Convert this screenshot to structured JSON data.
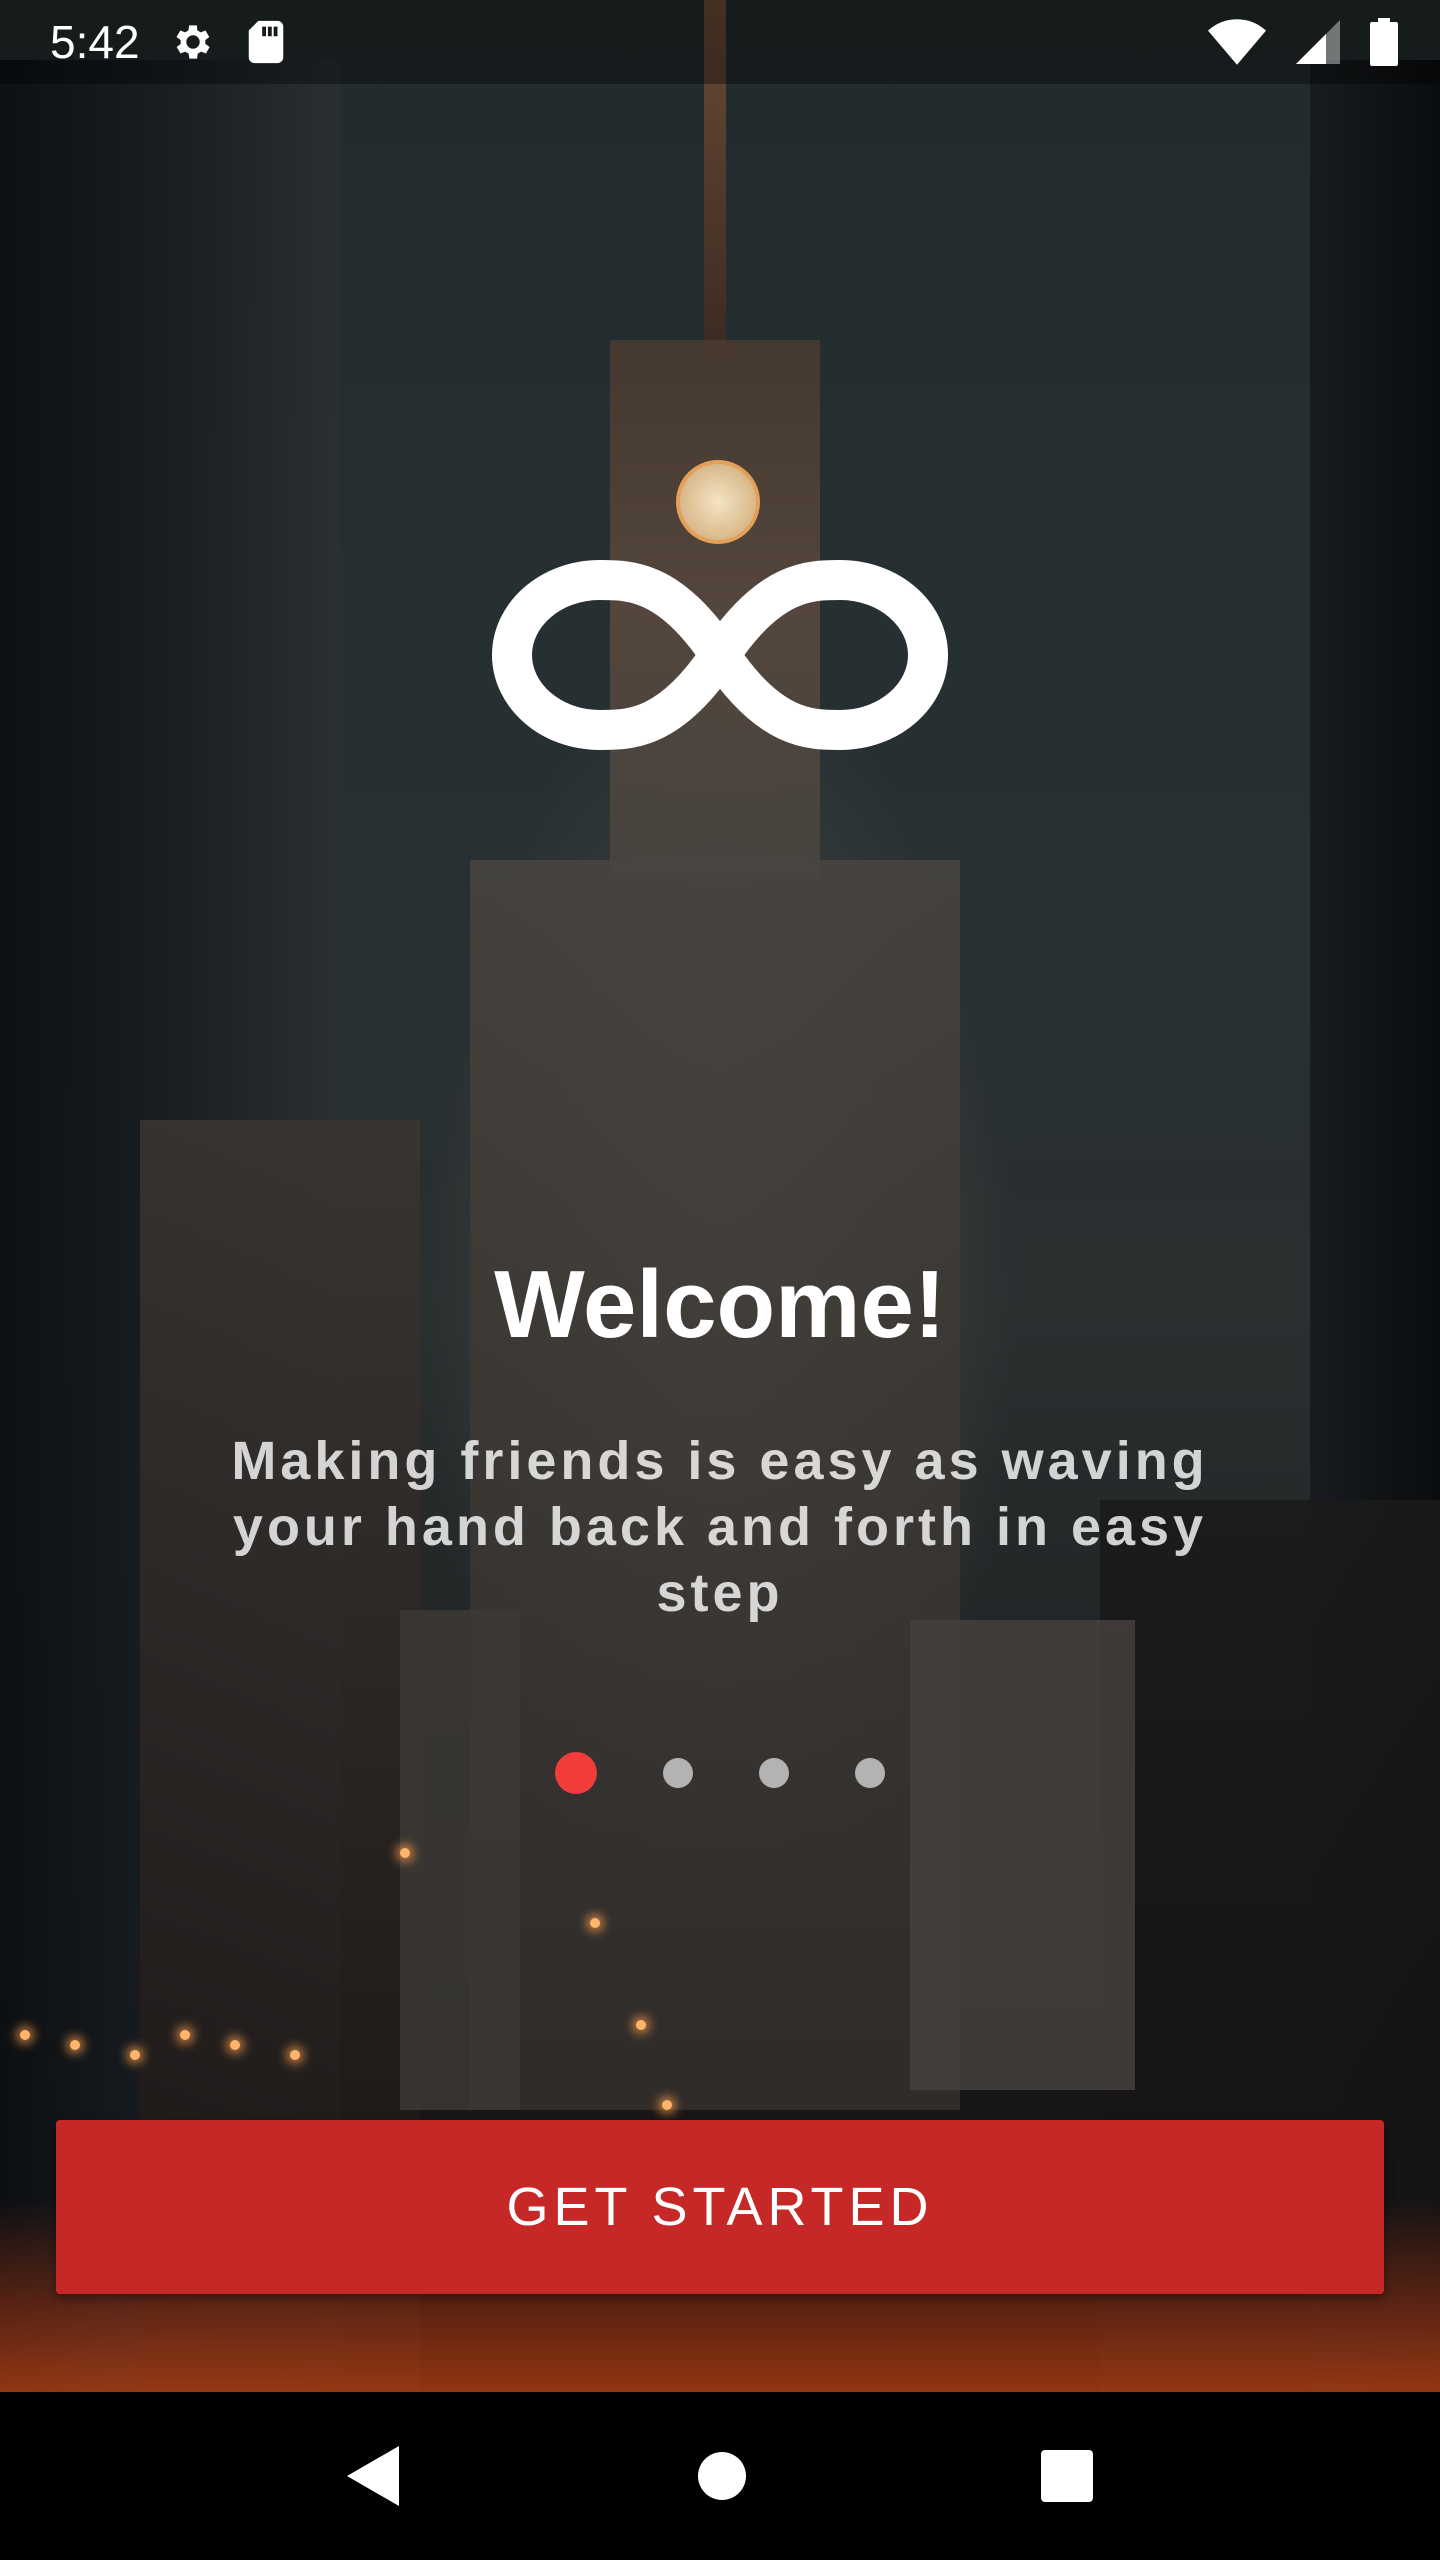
{
  "status_bar": {
    "time": "5:42",
    "icons": [
      "settings-icon",
      "sd-card-icon",
      "wifi-icon",
      "signal-icon",
      "battery-icon"
    ]
  },
  "logo": {
    "icon": "infinity-logo-icon"
  },
  "onboarding": {
    "title": "Welcome!",
    "subtitle": "Making friends is easy as waving your hand back and forth in easy step",
    "page_count": 4,
    "active_page": 1,
    "active_dot_color": "#f23b3b",
    "inactive_dot_color": "#b3b3b3"
  },
  "cta": {
    "label": "GET STARTED",
    "color": "#c62828"
  },
  "nav_bar": {
    "icons": [
      "back-icon",
      "home-icon",
      "recents-icon"
    ]
  }
}
